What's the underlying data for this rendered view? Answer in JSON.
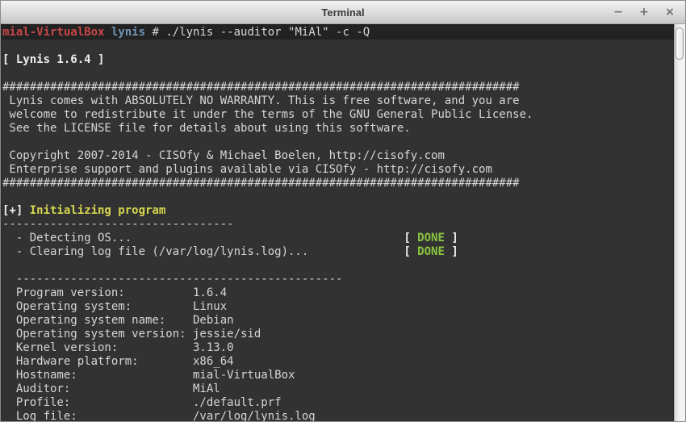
{
  "window": {
    "title": "Terminal",
    "controls": {
      "minimize": "−",
      "maximize": "+",
      "close": "×"
    }
  },
  "colors": {
    "bg": "#323232",
    "fg": "#d6d6d6",
    "bold": "#efefef",
    "red": "#c64747",
    "blue": "#7295b7",
    "yellow": "#d6d650",
    "green": "#8ac43f"
  },
  "terminal": {
    "prompt": {
      "host": "mial-VirtualBox",
      "dir": "lynis",
      "symbol": "#",
      "command": "./lynis --auditor \"MiAl\" -c -Q"
    },
    "program_info": {
      "program_version": "1.6.4",
      "operating_system": "Linux",
      "operating_system_name": "Debian",
      "operating_system_version": "jessie/sid",
      "kernel_version": "3.13.0",
      "hardware_platform": "x86_64",
      "hostname": "mial-VirtualBox",
      "auditor": "MiAl",
      "profile": "./default.prf",
      "log_file": "/var/log/lynis.log"
    },
    "lines": [
      {
        "style": "promptrow",
        "segs": [
          {
            "t": "mial-VirtualBox",
            "c": "red"
          },
          {
            "t": " ",
            "c": "fg"
          },
          {
            "t": "lynis",
            "c": "blue"
          },
          {
            "t": " # ./lynis --auditor \"MiAl\" -c -Q",
            "c": "fg"
          }
        ]
      },
      {
        "segs": []
      },
      {
        "segs": [
          {
            "t": "[ Lynis 1.6.4 ]",
            "c": "bold"
          }
        ]
      },
      {
        "segs": []
      },
      {
        "segs": [
          {
            "t": "############################################################################",
            "c": "fg"
          }
        ]
      },
      {
        "segs": [
          {
            "t": " Lynis comes with ABSOLUTELY NO WARRANTY. This is free software, and you are",
            "c": "fg"
          }
        ]
      },
      {
        "segs": [
          {
            "t": " welcome to redistribute it under the terms of the GNU General Public License.",
            "c": "fg"
          }
        ]
      },
      {
        "segs": [
          {
            "t": " See the LICENSE file for details about using this software.",
            "c": "fg"
          }
        ]
      },
      {
        "segs": []
      },
      {
        "segs": [
          {
            "t": " Copyright 2007-2014 - CISOfy & Michael Boelen, http://cisofy.com",
            "c": "fg"
          }
        ]
      },
      {
        "segs": [
          {
            "t": " Enterprise support and plugins available via CISOfy - http://cisofy.com",
            "c": "fg"
          }
        ]
      },
      {
        "segs": [
          {
            "t": "############################################################################",
            "c": "fg"
          }
        ]
      },
      {
        "segs": []
      },
      {
        "segs": [
          {
            "t": "[+] ",
            "c": "bold"
          },
          {
            "t": "Initializing program",
            "c": "yellow"
          }
        ]
      },
      {
        "segs": [
          {
            "t": "----------------------------------",
            "c": "fg"
          }
        ]
      },
      {
        "segs": [
          {
            "t": "  - Detecting OS...",
            "c": "fg"
          },
          {
            "t": "                                        ",
            "c": "fg"
          },
          {
            "t": "[ ",
            "c": "bold"
          },
          {
            "t": "DONE",
            "c": "green"
          },
          {
            "t": " ]",
            "c": "bold"
          }
        ]
      },
      {
        "segs": [
          {
            "t": "  - Clearing log file (/var/log/lynis.log)...",
            "c": "fg"
          },
          {
            "t": "              ",
            "c": "fg"
          },
          {
            "t": "[ ",
            "c": "bold"
          },
          {
            "t": "DONE",
            "c": "green"
          },
          {
            "t": " ]",
            "c": "bold"
          }
        ]
      },
      {
        "segs": []
      },
      {
        "segs": [
          {
            "t": "  ------------------------------------------------",
            "c": "fg"
          }
        ]
      },
      {
        "segs": [
          {
            "t": "  Program version:          1.6.4",
            "c": "fg"
          }
        ]
      },
      {
        "segs": [
          {
            "t": "  Operating system:         Linux",
            "c": "fg"
          }
        ]
      },
      {
        "segs": [
          {
            "t": "  Operating system name:    Debian",
            "c": "fg"
          }
        ]
      },
      {
        "segs": [
          {
            "t": "  Operating system version: jessie/sid",
            "c": "fg"
          }
        ]
      },
      {
        "segs": [
          {
            "t": "  Kernel version:           3.13.0",
            "c": "fg"
          }
        ]
      },
      {
        "segs": [
          {
            "t": "  Hardware platform:        x86_64",
            "c": "fg"
          }
        ]
      },
      {
        "segs": [
          {
            "t": "  Hostname:                 mial-VirtualBox",
            "c": "fg"
          }
        ]
      },
      {
        "segs": [
          {
            "t": "  Auditor:                  MiAl",
            "c": "fg"
          }
        ]
      },
      {
        "segs": [
          {
            "t": "  Profile:                  ./default.prf",
            "c": "fg"
          }
        ]
      },
      {
        "segs": [
          {
            "t": "  Log file:                 /var/log/lynis.log",
            "c": "fg"
          }
        ]
      }
    ]
  }
}
